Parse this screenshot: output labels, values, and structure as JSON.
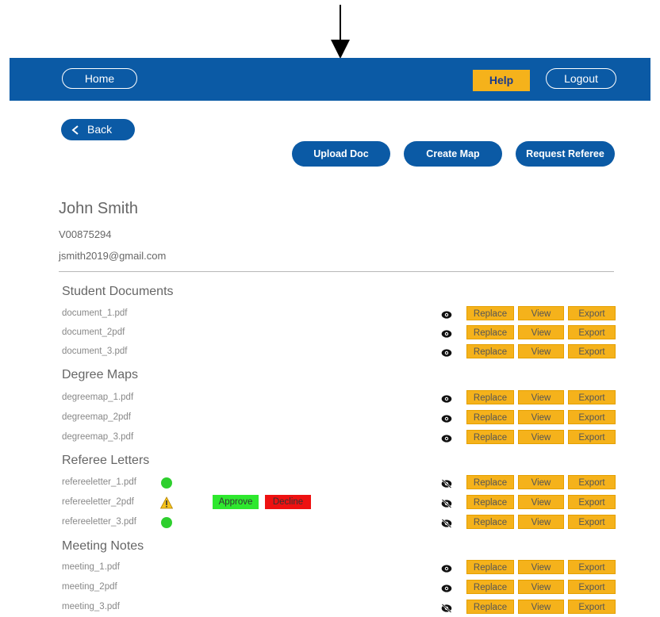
{
  "header": {
    "home_label": "Home",
    "help_label": "Help",
    "logout_label": "Logout"
  },
  "toolbar": {
    "back_label": "Back",
    "upload_label": "Upload Doc",
    "create_map_label": "Create Map",
    "request_referee_label": "Request Referee"
  },
  "profile": {
    "name": "John Smith",
    "student_id": "V00875294",
    "email": "jsmith2019@gmail.com"
  },
  "row_buttons": {
    "replace": "Replace",
    "view": "View",
    "export": "Export",
    "approve": "Approve",
    "decline": "Decline"
  },
  "sections": [
    {
      "title": "Student Documents",
      "files": [
        {
          "name": "document_1.pdf",
          "visibility": "eye-icon"
        },
        {
          "name": "document_2pdf",
          "visibility": "eye-icon"
        },
        {
          "name": "document_3.pdf",
          "visibility": "eye-icon"
        }
      ]
    },
    {
      "title": "Degree Maps",
      "files": [
        {
          "name": "degreemap_1.pdf",
          "visibility": "eye-icon"
        },
        {
          "name": "degreemap_2pdf",
          "visibility": "eye-icon"
        },
        {
          "name": "degreemap_3.pdf",
          "visibility": "eye-icon"
        }
      ]
    },
    {
      "title": "Referee Letters",
      "files": [
        {
          "name": "refereeletter_1.pdf",
          "visibility": "eye-slash-icon",
          "status": "approved-dot-icon"
        },
        {
          "name": "refereeletter_2pdf",
          "visibility": "eye-slash-icon",
          "status": "warning-icon"
        },
        {
          "name": "refereeletter_3.pdf",
          "visibility": "eye-slash-icon",
          "status": "approved-dot-icon"
        }
      ]
    },
    {
      "title": "Meeting Notes",
      "files": [
        {
          "name": "meeting_1.pdf",
          "visibility": "eye-icon"
        },
        {
          "name": "meeting_2pdf",
          "visibility": "eye-icon"
        },
        {
          "name": "meeting_3.pdf",
          "visibility": "eye-slash-icon"
        }
      ]
    }
  ],
  "colors": {
    "brand_blue": "#0b5aa5",
    "accent_yellow": "#f5b21b",
    "approve_green": "#2ee82e",
    "decline_red": "#ee1111"
  }
}
